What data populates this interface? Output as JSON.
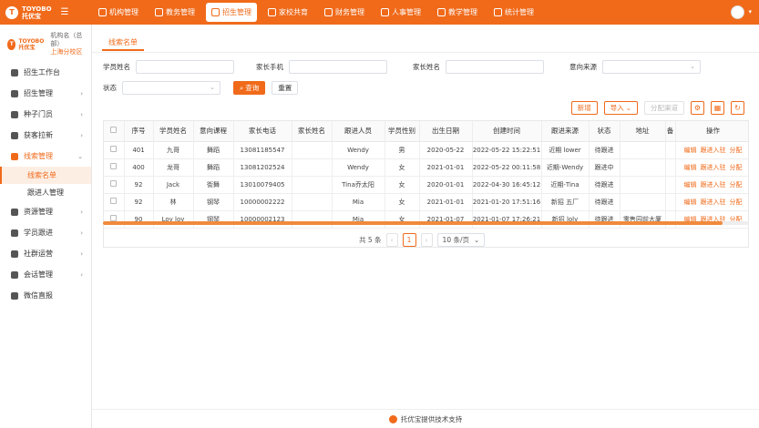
{
  "brand": {
    "logo_top": "TOYOBO",
    "logo_name": "托优宝",
    "sidebar_top": "TOYOBO",
    "sidebar_name": "托优宝",
    "org": "机构名（总部）",
    "campus": "上海分校区"
  },
  "topnav": [
    {
      "label": "机构管理",
      "active": false
    },
    {
      "label": "教务管理",
      "active": false
    },
    {
      "label": "招生管理",
      "active": true
    },
    {
      "label": "家校共育",
      "active": false
    },
    {
      "label": "财务管理",
      "active": false
    },
    {
      "label": "人事管理",
      "active": false
    },
    {
      "label": "教学管理",
      "active": false
    },
    {
      "label": "统计管理",
      "active": false
    }
  ],
  "sidebar": {
    "items": [
      {
        "label": "招生工作台",
        "arrow": ""
      },
      {
        "label": "招生管理",
        "arrow": "›"
      },
      {
        "label": "种子门员",
        "arrow": "›"
      },
      {
        "label": "获客拉新",
        "arrow": "›"
      },
      {
        "label": "线索管理",
        "arrow": "⌄",
        "open": true
      }
    ],
    "subs": [
      {
        "label": "线索名单",
        "active": true
      },
      {
        "label": "跟进人管理",
        "active": false
      }
    ],
    "items2": [
      {
        "label": "资源管理",
        "arrow": "›"
      },
      {
        "label": "学员跟进",
        "arrow": "›"
      },
      {
        "label": "社群运营",
        "arrow": "›"
      },
      {
        "label": "会话管理",
        "arrow": "›"
      },
      {
        "label": "微信直报",
        "arrow": ""
      }
    ]
  },
  "tab": {
    "label": "线索名单"
  },
  "filters": {
    "student_name_label": "学员姓名",
    "parent_phone_label": "家长手机",
    "parent_name_label": "家长姓名",
    "source_label": "意向来源",
    "status_label": "状态",
    "search_label": "查询",
    "reset_label": "重置"
  },
  "toolbar": {
    "add": "新增",
    "import": "导入",
    "assign": "分配渠道"
  },
  "table": {
    "headers": [
      "",
      "序号",
      "学员姓名",
      "意向课程",
      "家长电话",
      "家长姓名",
      "跟进人员",
      "学员性别",
      "出生日期",
      "创建时间",
      "跟进来源",
      "状态",
      "地址",
      "备",
      "操作"
    ],
    "rows": [
      [
        "",
        "401",
        "九哥",
        "舞蹈",
        "13081185547",
        "",
        "Wendy",
        "男",
        "2020-05-22",
        "2022-05-22 15:22:51",
        "近期 lower",
        "待跟进",
        "",
        "",
        [
          "编辑",
          "跟进入驻",
          "分配"
        ]
      ],
      [
        "",
        "400",
        "龙哥",
        "舞蹈",
        "13081202524",
        "",
        "Wendy",
        "女",
        "2021-01-01",
        "2022-05-22 00:11:58",
        "近期-Wendy",
        "跟进中",
        "",
        "",
        [
          "编辑",
          "跟进入驻",
          "分配"
        ]
      ],
      [
        "",
        "92",
        "Jack",
        "街舞",
        "13010079405",
        "",
        "Tina乔太阳",
        "女",
        "2020-01-01",
        "2022-04-30 16:45:12",
        "近期-Tina",
        "待跟进",
        "",
        "",
        [
          "编辑",
          "跟进入驻",
          "分配"
        ]
      ],
      [
        "",
        "92",
        "林",
        "钢琴",
        "10000002222",
        "",
        "Mia",
        "女",
        "2021-01-01",
        "2021-01-20 17:51:16",
        "新招 五厂",
        "待跟进",
        "",
        "",
        [
          "编辑",
          "跟进入驻",
          "分配"
        ]
      ],
      [
        "",
        "90",
        "Loy loy",
        "钢琴",
        "10000002123",
        "",
        "Mia",
        "女",
        "2021-01-07",
        "2021-01-07 17:26:21",
        "新招 loly",
        "待跟进",
        "零售园前大厦",
        "",
        [
          "编辑",
          "跟进入驻",
          "分配"
        ]
      ]
    ]
  },
  "pager": {
    "total": "共 5 条",
    "page": "1",
    "size": "10 条/页"
  },
  "footer": {
    "text": "托优宝提供技术支持"
  },
  "colors": {
    "accent": "#f06a1a"
  }
}
